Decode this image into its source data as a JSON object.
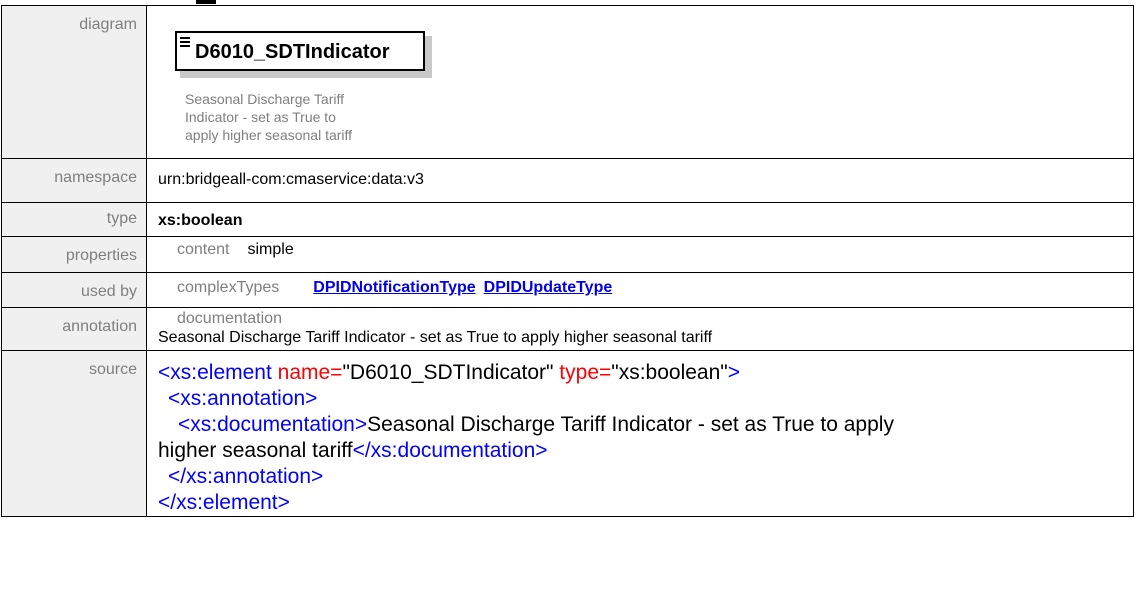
{
  "rows": {
    "diagram": {
      "label": "diagram"
    },
    "namespace": {
      "label": "namespace",
      "value": "urn:bridgeall-com:cmaservice:data:v3"
    },
    "type": {
      "label": "type",
      "value": "xs:boolean"
    },
    "properties": {
      "label": "properties",
      "key": "content",
      "value": "simple"
    },
    "used_by": {
      "label": "used by",
      "key": "complexTypes",
      "links": [
        "DPIDNotificationType",
        "DPIDUpdateType"
      ]
    },
    "annotation": {
      "label": "annotation",
      "key": "documentation",
      "text": "Seasonal Discharge Tariff Indicator - set as True to apply higher seasonal tariff"
    },
    "source": {
      "label": "source"
    }
  },
  "diagram": {
    "element_name": "D6010_SDTIndicator",
    "doc_lines": [
      "Seasonal Discharge Tariff",
      "Indicator - set as True to",
      "apply higher seasonal tariff"
    ]
  },
  "source_code": {
    "line1": {
      "open": "<xs:element",
      "attr1": " name=",
      "val1": "\"D6010_SDTIndicator\"",
      "attr2": " type=",
      "val2": "\"xs:boolean\"",
      "close": ">"
    },
    "line2": "<xs:annotation>",
    "line3_open": "<xs:documentation>",
    "line3_text": "Seasonal Discharge Tariff Indicator - set as True to apply",
    "line4_text": "higher seasonal tariff",
    "line4_close": "</xs:documentation>",
    "line5": "</xs:annotation>",
    "line6": "</xs:element>"
  },
  "colors": {
    "tag": "#0000ff",
    "attribute": "#ff0000",
    "link": "#0000ee",
    "label": "#7f7f7f",
    "label_bg": "#f0f0f0"
  }
}
